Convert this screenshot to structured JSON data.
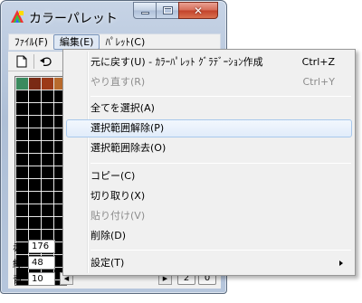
{
  "window": {
    "title": "カラーパレット",
    "close_glyph": "✕"
  },
  "menubar": {
    "items": [
      {
        "label": "ﾌｧｲﾙ(F)"
      },
      {
        "label": "編集(E)"
      },
      {
        "label": "ﾊﾟﾚｯﾄ(C)"
      }
    ]
  },
  "palette": {
    "swatch_colors": [
      "#3a8a5e",
      "#7a2a14",
      "#9c3a18",
      "#b86a2c"
    ]
  },
  "fields": {
    "red_label": "赤",
    "red_value": "176",
    "green_label": "緑",
    "green_value": "48",
    "blue_label": "青",
    "blue_value": "10"
  },
  "bottom_buttons": {
    "b1": "2",
    "b2": "0"
  },
  "edit_menu": {
    "items": [
      {
        "label": "元に戻す(U) - ｶﾗｰﾊﾟﾚｯﾄ ｸﾞﾗﾃﾞｰｼｮﾝ作成",
        "shortcut": "Ctrl+Z"
      },
      {
        "label": "やり直す(R)",
        "shortcut": "Ctrl+Y"
      },
      {
        "label": "全てを選択(A)"
      },
      {
        "label": "選択範囲解除(P)"
      },
      {
        "label": "選択範囲除去(O)"
      },
      {
        "label": "コピー(C)"
      },
      {
        "label": "切り取り(X)"
      },
      {
        "label": "貼り付け(V)"
      },
      {
        "label": "削除(D)"
      },
      {
        "label": "設定(T)"
      }
    ]
  }
}
